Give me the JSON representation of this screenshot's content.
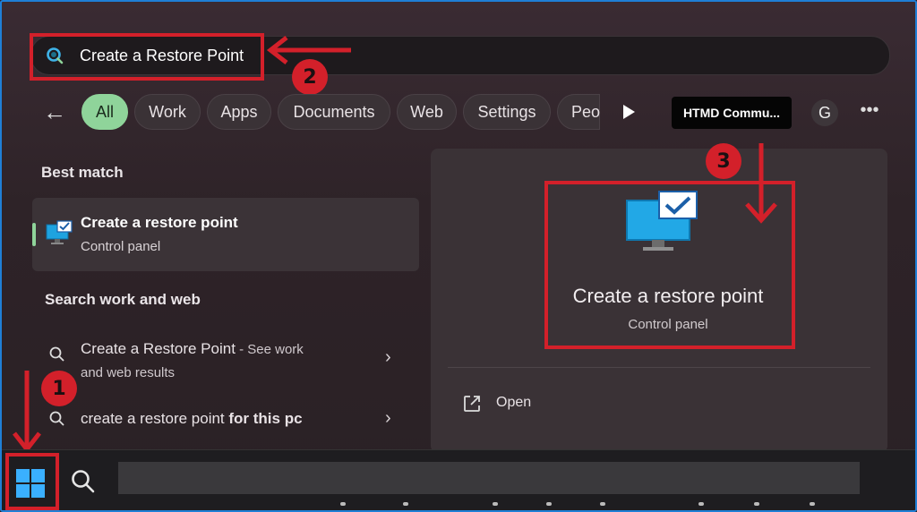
{
  "search": {
    "query": "Create a Restore Point"
  },
  "filters": {
    "back": "←",
    "chips": [
      "All",
      "Work",
      "Apps",
      "Documents",
      "Web",
      "Settings",
      "Peo"
    ],
    "account_label": "HTMD Commu...",
    "avatar_initial": "G",
    "more": "•••"
  },
  "left": {
    "best_match_heading": "Best match",
    "best_match": {
      "title": "Create a restore point",
      "subtitle": "Control panel"
    },
    "search_heading": "Search work and web",
    "results": [
      {
        "title": "Create a Restore Point",
        "suffix": " - See work",
        "line2": "and web results"
      },
      {
        "prefix": "create a restore point ",
        "bold": "for this pc"
      }
    ]
  },
  "right": {
    "title": "Create a restore point",
    "subtitle": "Control panel",
    "open_label": "Open"
  },
  "annotations": {
    "n1": "1",
    "n2": "2",
    "n3": "3",
    "color": "#d3202a"
  },
  "colors": {
    "accent": "#8fd49a",
    "border": "#1f7fd6"
  }
}
